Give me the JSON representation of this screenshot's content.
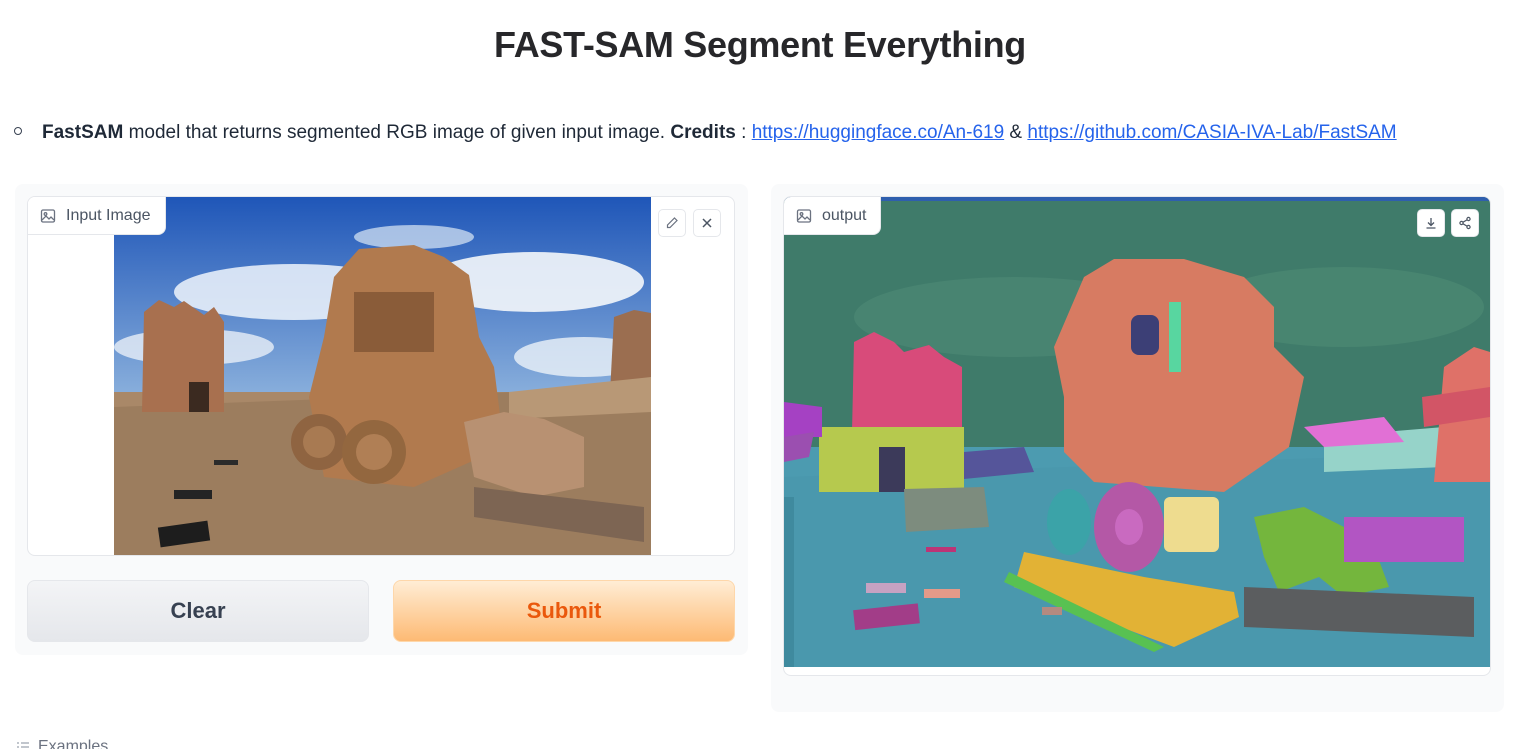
{
  "page": {
    "title": "FAST-SAM Segment Everything"
  },
  "description": {
    "model_name": "FastSAM",
    "text": " model that returns segmented RGB image of given input image. ",
    "credits_label": "Credits",
    "credits_sep": " : ",
    "link1": "https://huggingface.co/An-619",
    "amp": " & ",
    "link2": "https://github.com/CASIA-IVA-Lab/FastSAM"
  },
  "input_panel": {
    "label": "Input Image",
    "icons": [
      "image-icon",
      "pencil-icon",
      "close-icon"
    ]
  },
  "buttons": {
    "clear_label": "Clear",
    "submit_label": "Submit"
  },
  "output_panel": {
    "label": "output",
    "icons": [
      "image-icon",
      "download-icon",
      "share-icon"
    ]
  },
  "examples": {
    "label": "Examples"
  },
  "colors": {
    "accent": "#ea580c",
    "submit_bg": "#fdba74",
    "link": "#2563eb"
  }
}
